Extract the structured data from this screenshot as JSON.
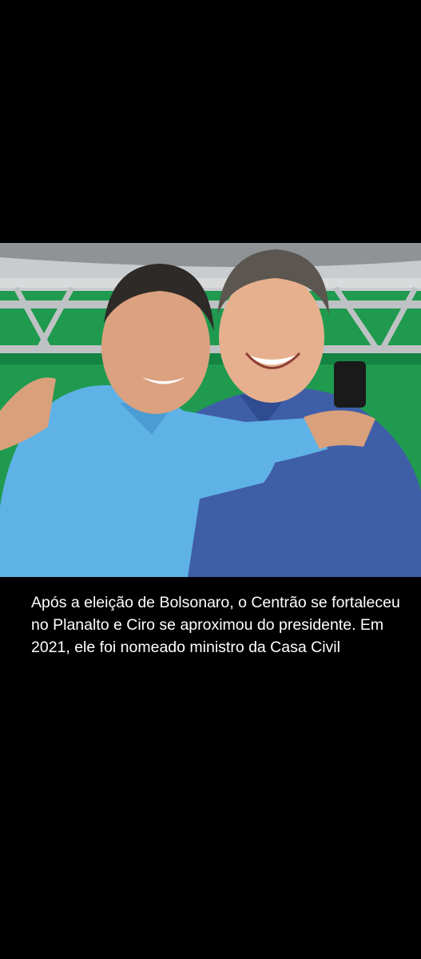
{
  "story": {
    "photo_description_icon": "photo-two-men-embracing",
    "caption": "Após a eleição de Bolsonaro, o Centrão se fortaleceu no Planalto e Ciro se aproximou do presidente. Em 2021, ele foi nomeado ministro da Casa Civil"
  },
  "colors": {
    "background": "#000000",
    "caption_text": "#ffffff",
    "tent_green": "#1f9a4e",
    "left_shirt": "#5fb2e6",
    "right_shirt": "#3f5ea8"
  }
}
